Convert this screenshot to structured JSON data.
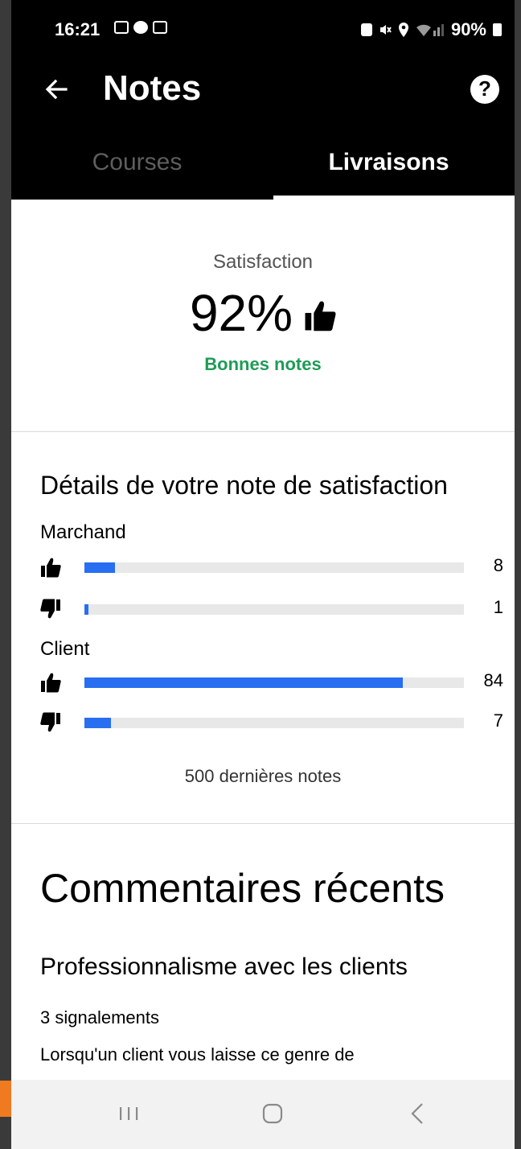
{
  "status_bar": {
    "time": "16:21",
    "battery": "90%",
    "icons": [
      "gallery-icon",
      "chat-icon",
      "card-icon",
      "lock-icon",
      "mute-icon",
      "location-icon",
      "wifi-icon",
      "signal-icon",
      "battery-icon"
    ]
  },
  "header": {
    "title": "Notes",
    "back_icon": "back-arrow-icon",
    "help_icon": "help-icon"
  },
  "tabs": [
    {
      "label": "Courses",
      "active": false
    },
    {
      "label": "Livraisons",
      "active": true
    }
  ],
  "satisfaction": {
    "label": "Satisfaction",
    "value": "92%",
    "status": "Bonnes notes"
  },
  "details": {
    "title": "Détails de votre note de satisfaction",
    "groups": [
      {
        "label": "Marchand",
        "rows": [
          {
            "type": "thumbs-up",
            "count": "8",
            "fraction": 0.08
          },
          {
            "type": "thumbs-down",
            "count": "1",
            "fraction": 0.01
          }
        ]
      },
      {
        "label": "Client",
        "rows": [
          {
            "type": "thumbs-up",
            "count": "84",
            "fraction": 0.84
          },
          {
            "type": "thumbs-down",
            "count": "7",
            "fraction": 0.07
          }
        ]
      }
    ],
    "footer": "500 dernières notes"
  },
  "comments": {
    "title": "Commentaires récents",
    "item_title": "Professionnalisme avec les clients",
    "item_count": "3 signalements",
    "item_text": "Lorsqu'un client vous laisse ce genre de"
  },
  "colors": {
    "accent": "#276ef1",
    "good": "#1f9b56"
  }
}
